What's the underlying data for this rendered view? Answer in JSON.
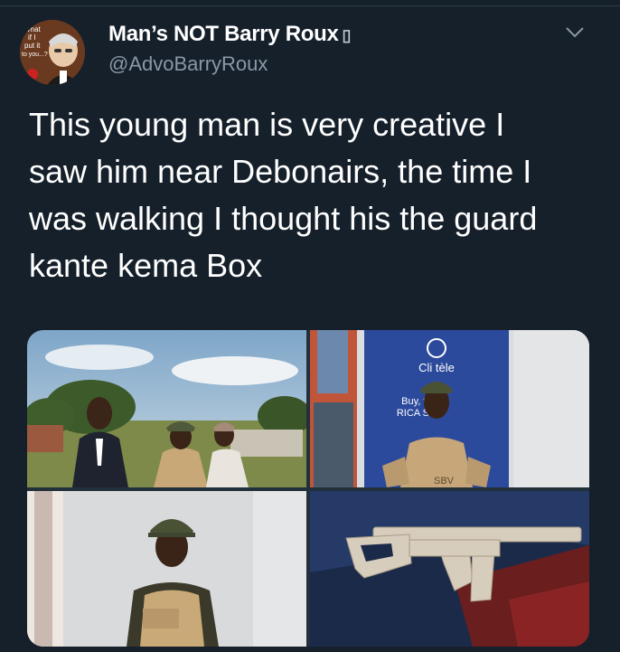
{
  "author": {
    "display_name": "Man’s NOT Barry Roux",
    "verified_glyph": "▯",
    "handle": "@AdvoBarryRoux",
    "avatar_text": [
      "What",
      "if I",
      "put it",
      "to you...?"
    ]
  },
  "tweet": {
    "lines": [
      "This young man is very creative I",
      "saw him near Debonairs, the time I",
      "was walking I thought his the guard",
      "kante kema Box"
    ]
  },
  "media": {
    "photo2_sign_title": "Cli  tèle",
    "photo2_sign_line1": "Buy,   t &",
    "photo2_sign_line2": "RICA   SIM",
    "photo2_vest_text": "SBV"
  },
  "icons": {
    "more": "chevron-down-icon"
  },
  "colors": {
    "background": "#15202b",
    "text": "#ffffff",
    "secondary_text": "#8b98a5"
  }
}
